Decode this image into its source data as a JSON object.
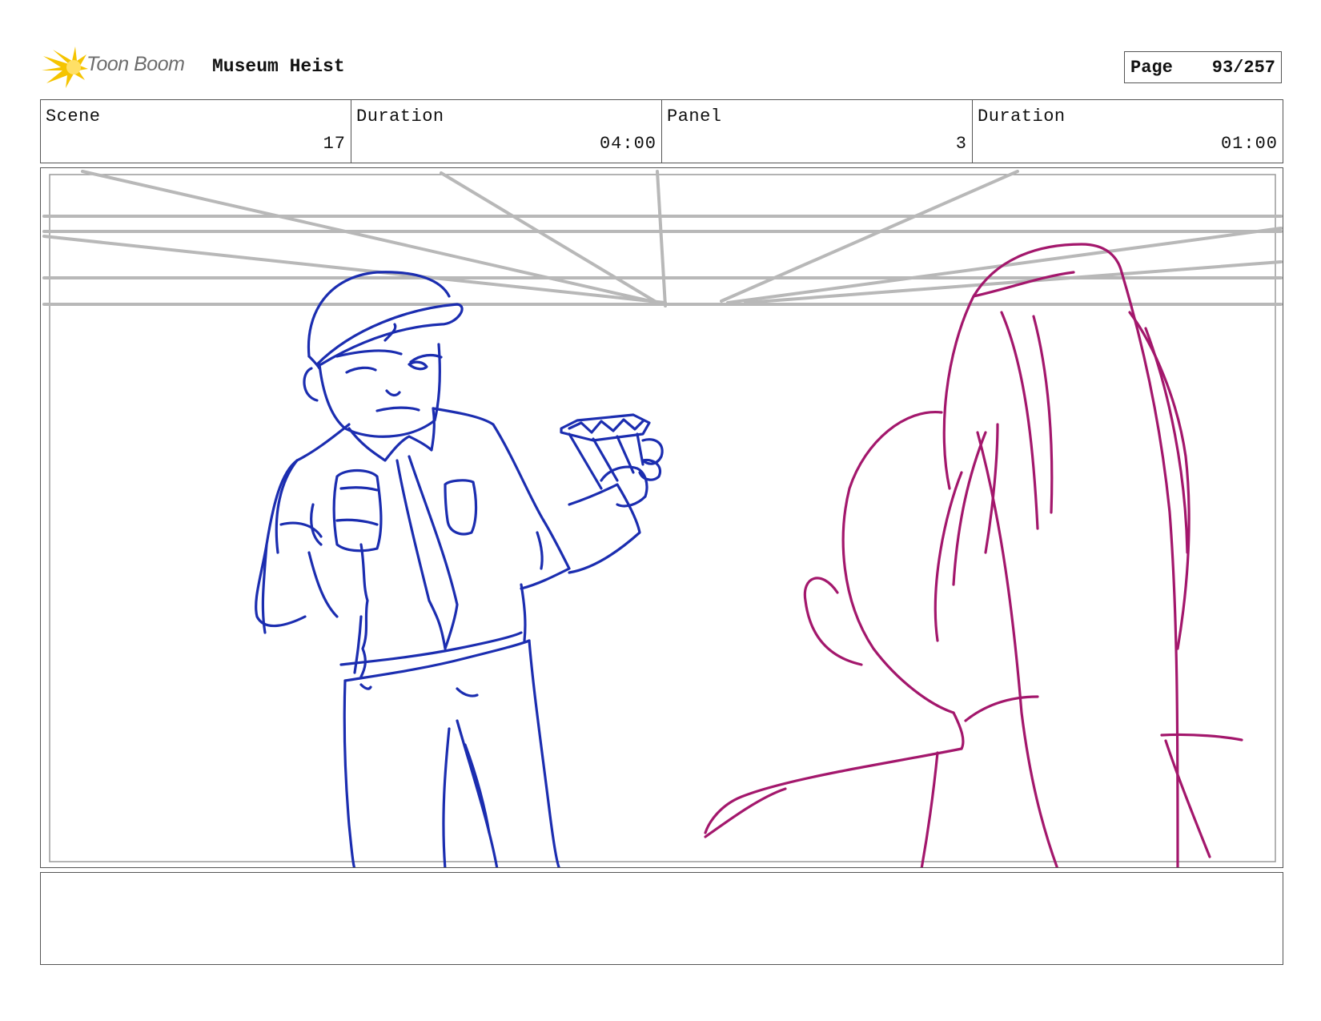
{
  "header": {
    "logo_text": "Toon Boom",
    "project_title": "Museum Heist",
    "page_label": "Page",
    "page_number": "93/257"
  },
  "info": {
    "scene_label": "Scene",
    "scene_value": "17",
    "scene_duration_label": "Duration",
    "scene_duration_value": "04:00",
    "panel_label": "Panel",
    "panel_value": "3",
    "panel_duration_label": "Duration",
    "panel_duration_value": "01:00"
  },
  "caption": {
    "text": ""
  },
  "colors": {
    "guard_sketch": "#1b2db0",
    "girl_sketch": "#a3176c",
    "guide_lines": "#b8b8b8",
    "logo_accent": "#f5c400"
  }
}
